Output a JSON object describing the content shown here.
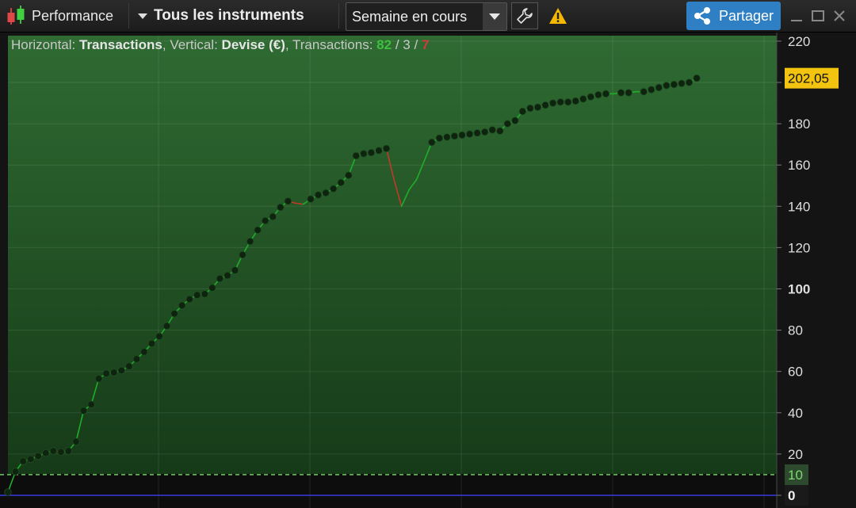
{
  "toolbar": {
    "title": "Performance",
    "instrument": "Tous les instruments",
    "period": "Semaine en cours",
    "share_label": "Partager"
  },
  "info": {
    "horizontal_label": "Horizontal:",
    "horizontal_value": "Transactions",
    "vertical_label": "Vertical:",
    "vertical_value": "Devise (€)",
    "transactions_label": "Transactions:",
    "wins": "82",
    "neutral": "3",
    "losses": "7",
    "sep1": "/",
    "sep2": "/"
  },
  "colors": {
    "plot_bg_top": "#2f6b32",
    "plot_bg_bottom": "#163a18",
    "gain_line": "#1fae2a",
    "loss_line": "#c0392b",
    "marker": "#0e240f",
    "current_badge": "#f2c40f",
    "zero_line": "#3a3adf",
    "ref_line": "#7cdc6f",
    "share_button": "#2f7fc4"
  },
  "chart_data": {
    "type": "line",
    "title": "",
    "xlabel": "Transactions",
    "ylabel": "Devise (€)",
    "ylim": [
      -5,
      225
    ],
    "yticks": [
      0,
      20,
      40,
      60,
      80,
      100,
      120,
      140,
      160,
      180,
      200,
      220
    ],
    "ytick_labels": [
      "0",
      "20",
      "40",
      "60",
      "80",
      "100",
      "120",
      "140",
      "160",
      "180",
      "",
      "220"
    ],
    "current_value_label": "202,05",
    "current_value": 202.05,
    "reference_line": {
      "label": "10",
      "value": 10
    },
    "zero_line": {
      "label": "0",
      "value": 0
    },
    "grid": true,
    "series": [
      {
        "values": [
          1.5,
          11.5,
          16.5,
          17.5,
          19.0,
          20.5,
          21.5,
          21.0,
          21.5,
          26.0,
          41.0,
          44.0,
          56.5,
          59.0,
          59.5,
          60.5,
          62.5,
          66.0,
          69.5,
          73.5,
          77.0,
          82.0,
          88.0,
          92.0,
          95.0,
          97.0,
          97.5,
          100.5,
          105.0,
          106.5,
          109.0,
          116.5,
          123.0,
          128.5,
          133.0,
          135.0,
          139.5,
          142.5,
          141.5,
          141.0,
          143.5,
          145.5,
          146.5,
          148.5,
          151.5,
          155.0,
          164.5,
          165.5,
          166.0,
          167.0,
          168.0,
          153.0,
          140.0,
          148.0,
          153.0,
          162.0,
          171.0,
          173.0,
          173.5,
          174.0,
          174.5,
          175.0,
          175.5,
          176.0,
          177.0,
          176.5,
          180.0,
          181.5,
          186.0,
          187.5,
          188.0,
          189.0,
          190.0,
          190.5,
          190.5,
          191.0,
          192.0,
          193.0,
          194.0,
          194.5,
          194.5,
          195.0,
          195.0,
          195.5,
          195.5,
          196.5,
          197.5,
          198.5,
          199.0,
          199.5,
          200.0,
          202.05
        ],
        "markers": [
          0,
          1,
          2,
          3,
          4,
          5,
          6,
          7,
          8,
          9,
          10,
          11,
          12,
          13,
          14,
          15,
          16,
          17,
          18,
          19,
          20,
          21,
          22,
          23,
          24,
          25,
          26,
          27,
          28,
          29,
          30,
          31,
          32,
          33,
          34,
          35,
          36,
          37,
          40,
          41,
          42,
          43,
          44,
          45,
          46,
          47,
          48,
          49,
          50,
          56,
          57,
          58,
          59,
          60,
          61,
          62,
          63,
          64,
          65,
          66,
          67,
          68,
          69,
          70,
          71,
          72,
          73,
          74,
          75,
          76,
          77,
          78,
          79,
          81,
          82,
          84,
          85,
          86,
          87,
          88,
          89,
          90,
          91
        ]
      }
    ]
  }
}
